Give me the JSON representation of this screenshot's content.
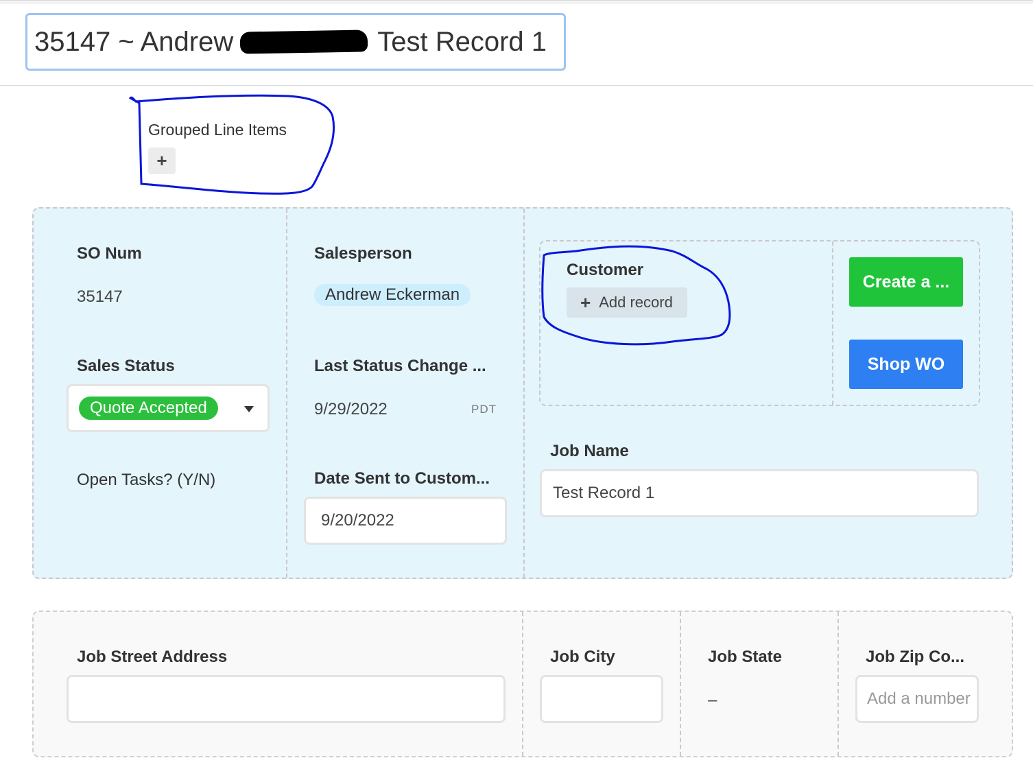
{
  "header": {
    "title_prefix": "35147 ~ Andrew",
    "title_suffix": "Test Record 1"
  },
  "grouped": {
    "label": "Grouped Line Items",
    "add_icon": "+"
  },
  "fields": {
    "so_num": {
      "label": "SO Num",
      "value": "35147"
    },
    "sales_status": {
      "label": "Sales Status",
      "value": "Quote Accepted",
      "color": "#2bbf3d"
    },
    "open_tasks": {
      "label": "Open Tasks? (Y/N)"
    },
    "salesperson": {
      "label": "Salesperson",
      "value": "Andrew Eckerman"
    },
    "last_status_change": {
      "label": "Last Status Change ...",
      "value": "9/29/2022",
      "timezone": "PDT"
    },
    "date_sent": {
      "label": "Date Sent to Custom...",
      "value": "9/20/2022"
    },
    "customer": {
      "label": "Customer",
      "add_icon": "+",
      "add_label": "Add record"
    },
    "job_name": {
      "label": "Job Name",
      "value": "Test Record 1"
    }
  },
  "buttons": {
    "create": {
      "label": "Create a ...",
      "color": "#20c43b"
    },
    "shop_wo": {
      "label": "Shop WO",
      "color": "#2d7ff2"
    }
  },
  "job": {
    "street": {
      "label": "Job Street Address",
      "value": ""
    },
    "city": {
      "label": "Job City",
      "value": ""
    },
    "state": {
      "label": "Job State",
      "value": "–"
    },
    "zip": {
      "label": "Job Zip Co...",
      "placeholder": "Add a number"
    }
  },
  "annotation_color": "#0a16d8"
}
